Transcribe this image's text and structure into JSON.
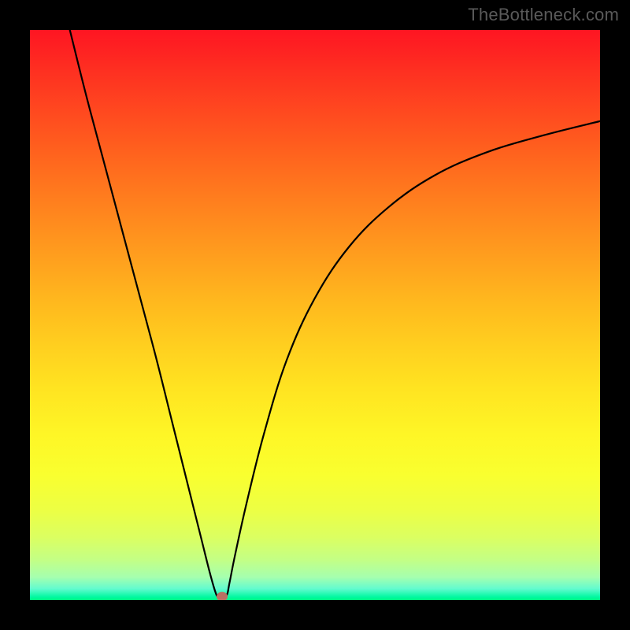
{
  "watermark": "TheBottleneck.com",
  "colors": {
    "background": "#000000",
    "watermark_text": "#5a5a5a",
    "curve": "#000000",
    "marker": "#b97062",
    "gradient_top": "#fe1522",
    "gradient_bottom": "#00f77f"
  },
  "chart_data": {
    "type": "line",
    "title": "",
    "xlabel": "",
    "ylabel": "",
    "xlim": [
      0,
      100
    ],
    "ylim": [
      0,
      100
    ],
    "grid": false,
    "legend": false,
    "series": [
      {
        "name": "bottleneck-curve",
        "x": [
          7,
          10,
          14,
          18,
          22,
          25,
          28,
          30,
          31.5,
          32.5,
          33,
          33.5,
          34.5,
          35,
          36,
          38,
          41,
          45,
          50,
          56,
          63,
          71,
          80,
          90,
          100
        ],
        "y": [
          100,
          88,
          73,
          58,
          43,
          31,
          19,
          11,
          5,
          1.5,
          0.5,
          0.5,
          0.8,
          3,
          8,
          17,
          29,
          42,
          53,
          62,
          69,
          74.5,
          78.5,
          81.5,
          84
        ]
      }
    ],
    "marker": {
      "x": 33.7,
      "y": 0.6
    },
    "annotations": []
  }
}
